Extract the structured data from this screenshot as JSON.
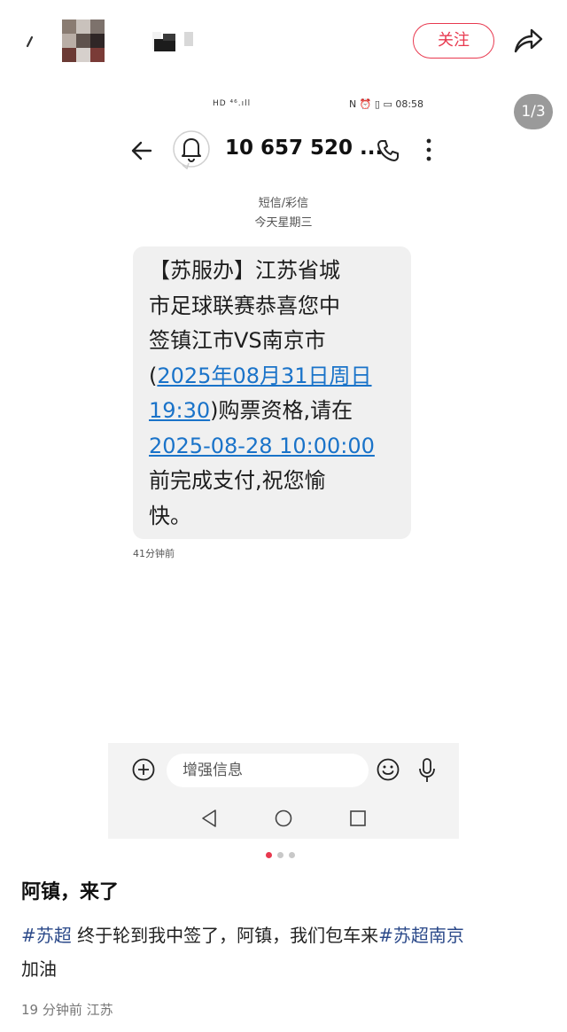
{
  "header": {
    "follow_label": "关注",
    "icons": [
      "back-mark",
      "blurred-avatar",
      "blurred-username",
      "share-icon"
    ]
  },
  "screenshot": {
    "page_counter": "1/3",
    "status_left": "HD ⁴⁶.ıll",
    "status_right": "N ⏰ ▯ ▭ 08:58",
    "contact_number": "10 657 520 ...",
    "sms_type": "短信/彩信",
    "date_label": "今天星期三",
    "message_lines": [
      "【苏服办】江苏省城",
      "市足球联赛恭喜您中",
      "签镇江市VS南京市"
    ],
    "msg_line4_prefix": "(",
    "msg_link1_a": "2025年08月31日周日",
    "msg_link1_b": "19:30",
    "msg_line5_suffix": ")购票资格,请在",
    "msg_link2": "2025-08-28 10:00:00",
    "msg_line7": "前完成支付,祝您愉",
    "msg_line8": "快。",
    "message_time": "41分钟前",
    "input_placeholder": "增强信息",
    "icons": [
      "back-arrow-icon",
      "bell-icon",
      "phone-icon",
      "more-icon",
      "add-icon",
      "emoji-icon",
      "mic-icon"
    ]
  },
  "carousel": {
    "active_index": 0,
    "count": 3,
    "active_color": "#e8394f"
  },
  "post": {
    "title": "阿镇，来了",
    "tag1": "#苏超",
    "text": " 终于轮到我中签了，阿镇，我们包车来",
    "tag2": "#苏超南京",
    "text_end": "加油",
    "meta": "19 分钟前  江苏"
  },
  "colors": {
    "accent": "#e8394f",
    "link": "#1a73c9",
    "tag": "#2c4a8a"
  }
}
